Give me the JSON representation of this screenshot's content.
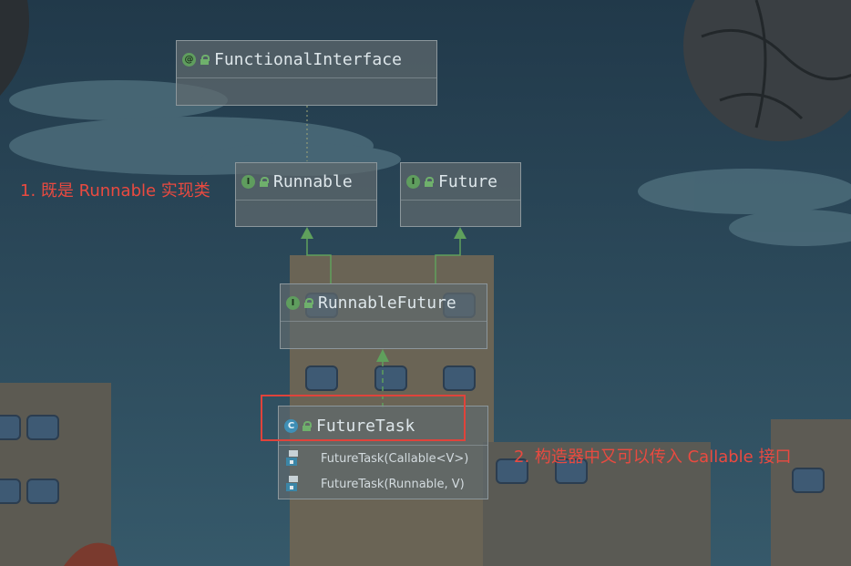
{
  "nodes": {
    "functional_interface": {
      "name": "FunctionalInterface",
      "kind_badge": "@",
      "icon": "annotation-icon"
    },
    "runnable": {
      "name": "Runnable",
      "kind_badge": "I",
      "icon": "interface-icon"
    },
    "future": {
      "name": "Future",
      "kind_badge": "I",
      "icon": "interface-icon"
    },
    "runnable_future": {
      "name": "RunnableFuture",
      "kind_badge": "I",
      "icon": "interface-icon"
    },
    "future_task": {
      "name": "FutureTask",
      "kind_badge": "C",
      "icon": "class-icon",
      "members": [
        "FutureTask(Callable<V>)",
        "FutureTask(Runnable, V)"
      ]
    }
  },
  "annotations": {
    "note1": "1. 既是 Runnable 实现类",
    "note2": "2. 构造器中又可以传入 Callable 接口"
  },
  "colors": {
    "sky": "#2d4957",
    "node_fill": "#5f696e",
    "inherit_arrow": "#5fa05c",
    "annotation_red": "#e0433b"
  }
}
